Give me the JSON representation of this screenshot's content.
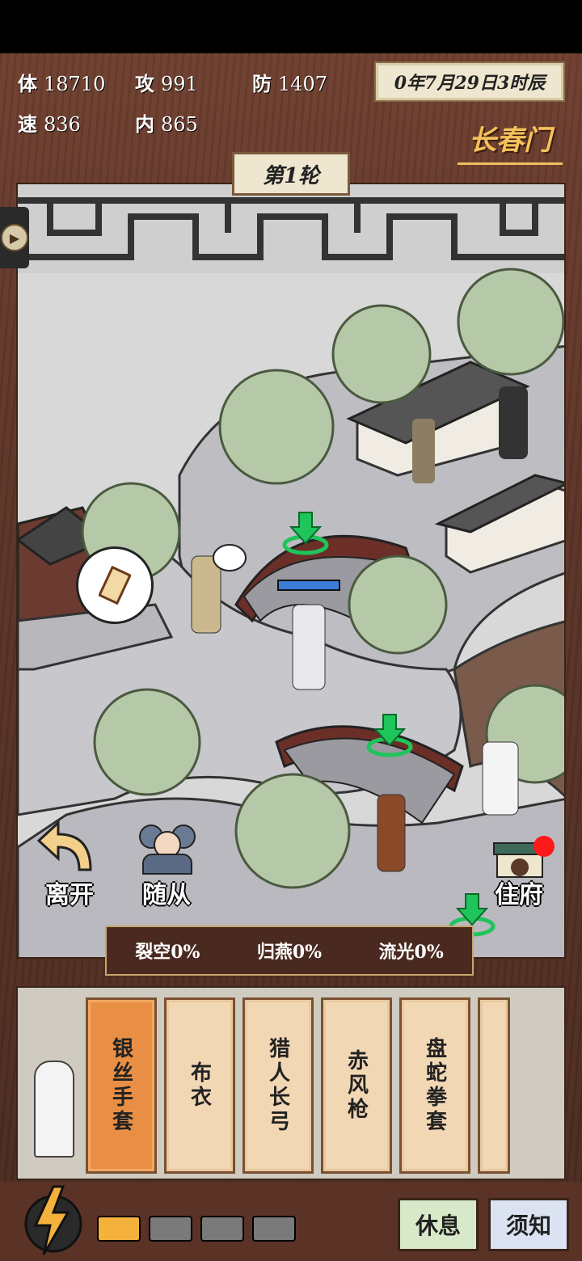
{
  "stats": {
    "hp_label": "体",
    "hp_value": "18710",
    "atk_label": "攻",
    "atk_value": "991",
    "def_label": "防",
    "def_value": "1407",
    "spd_label": "速",
    "spd_value": "836",
    "inner_label": "内",
    "inner_value": "865"
  },
  "date": "0年7月29日3时辰",
  "sect_name": "长春门",
  "round": "第1轮",
  "actions": {
    "leave": "离开",
    "followers": "随从",
    "residence": "住府"
  },
  "buffs": [
    {
      "name": "裂空",
      "value": "0%"
    },
    {
      "name": "归燕",
      "value": "0%"
    },
    {
      "name": "流光",
      "value": "0%"
    }
  ],
  "cards": [
    {
      "label": "银丝手套",
      "selected": true
    },
    {
      "label": "布衣",
      "selected": false
    },
    {
      "label": "猎人长弓",
      "selected": false
    },
    {
      "label": "赤风枪",
      "selected": false
    },
    {
      "label": "盘蛇拳套",
      "selected": false
    }
  ],
  "energy_slots": [
    {
      "filled": true
    },
    {
      "filled": false
    },
    {
      "filled": false
    },
    {
      "filled": false
    }
  ],
  "buttons": {
    "rest": "休息",
    "notice": "须知"
  },
  "colors": {
    "frame": "#5b3326",
    "parchment": "#efe6cf",
    "accent_gold": "#f4c15a",
    "card_selected": "#e98f45",
    "card": "#f2d7b4",
    "energy_on": "#f4b23c",
    "marker_green": "#1fc45a",
    "notification": "#ff1a1a",
    "rest_btn": "#d7e9c8",
    "notice_btn": "#dbe3f2"
  },
  "icons": {
    "play": "play-icon",
    "leave": "curved-arrow-icon",
    "lightning": "lightning-icon",
    "map_marker": "green-arrow-icon",
    "quest": "scroll-icon"
  }
}
